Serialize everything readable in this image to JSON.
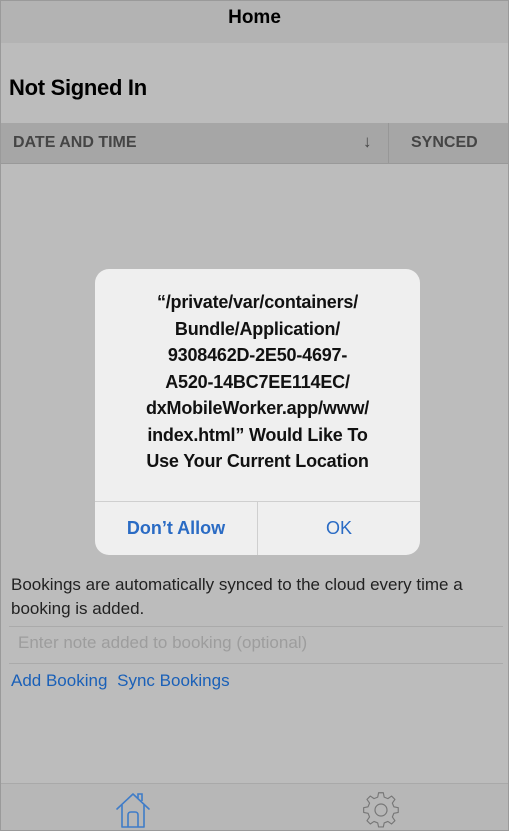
{
  "navbar": {
    "title": "Home"
  },
  "status": {
    "signin_label": "Not Signed In"
  },
  "table": {
    "columns": [
      "DATE AND TIME",
      "SYNCED"
    ],
    "sort_indicator": "↓",
    "rows": []
  },
  "alert": {
    "message_lines": [
      "“/private/var/containers/",
      "Bundle/Application/",
      "9308462D-2E50-4697-",
      "A520-14BC7EE114EC/",
      "dxMobileWorker.app/www/",
      "index.html” Would Like To",
      "Use Your Current Location"
    ],
    "deny_label": "Don’t Allow",
    "ok_label": "OK"
  },
  "info_text": "Bookings are automatically synced to the cloud every time a booking is added.",
  "note": {
    "placeholder": "Enter note added to booking (optional)",
    "value": ""
  },
  "actions": {
    "add_label": "Add Booking",
    "sync_label": "Sync Bookings"
  },
  "tabbar": {
    "items": [
      {
        "icon": "home-icon",
        "active": true
      },
      {
        "icon": "gear-icon",
        "active": false
      }
    ]
  },
  "colors": {
    "accent": "#1a60b8",
    "dim_overlay": "#bcbcbc",
    "alert_background": "#efefef"
  }
}
